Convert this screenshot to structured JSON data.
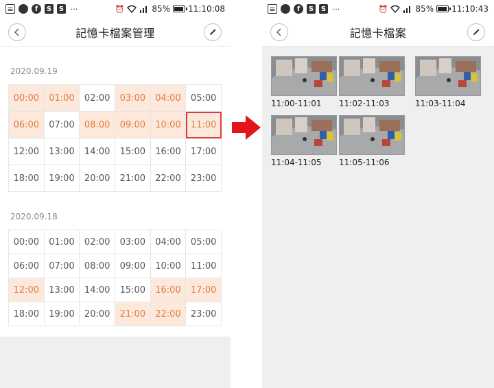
{
  "left": {
    "status": {
      "battery": "85%",
      "time": "11:10:08"
    },
    "title": "記憶卡檔案管理",
    "sections": [
      {
        "date": "2020.09.19",
        "slots": [
          {
            "t": "00:00",
            "has": true
          },
          {
            "t": "01:00",
            "has": true
          },
          {
            "t": "02:00",
            "has": false
          },
          {
            "t": "03:00",
            "has": true
          },
          {
            "t": "04:00",
            "has": true
          },
          {
            "t": "05:00",
            "has": false
          },
          {
            "t": "06:00",
            "has": true
          },
          {
            "t": "07:00",
            "has": false
          },
          {
            "t": "08:00",
            "has": true
          },
          {
            "t": "09:00",
            "has": true
          },
          {
            "t": "10:00",
            "has": true
          },
          {
            "t": "11:00",
            "has": true,
            "selected": true
          },
          {
            "t": "12:00",
            "has": false
          },
          {
            "t": "13:00",
            "has": false
          },
          {
            "t": "14:00",
            "has": false
          },
          {
            "t": "15:00",
            "has": false
          },
          {
            "t": "16:00",
            "has": false
          },
          {
            "t": "17:00",
            "has": false
          },
          {
            "t": "18:00",
            "has": false
          },
          {
            "t": "19:00",
            "has": false
          },
          {
            "t": "20:00",
            "has": false
          },
          {
            "t": "21:00",
            "has": false
          },
          {
            "t": "22:00",
            "has": false
          },
          {
            "t": "23:00",
            "has": false
          }
        ]
      },
      {
        "date": "2020.09.18",
        "slots": [
          {
            "t": "00:00",
            "has": false
          },
          {
            "t": "01:00",
            "has": false
          },
          {
            "t": "02:00",
            "has": false
          },
          {
            "t": "03:00",
            "has": false
          },
          {
            "t": "04:00",
            "has": false
          },
          {
            "t": "05:00",
            "has": false
          },
          {
            "t": "06:00",
            "has": false
          },
          {
            "t": "07:00",
            "has": false
          },
          {
            "t": "08:00",
            "has": false
          },
          {
            "t": "09:00",
            "has": false
          },
          {
            "t": "10:00",
            "has": false
          },
          {
            "t": "11:00",
            "has": false
          },
          {
            "t": "12:00",
            "has": true
          },
          {
            "t": "13:00",
            "has": false
          },
          {
            "t": "14:00",
            "has": false
          },
          {
            "t": "15:00",
            "has": false
          },
          {
            "t": "16:00",
            "has": true
          },
          {
            "t": "17:00",
            "has": true
          },
          {
            "t": "18:00",
            "has": false
          },
          {
            "t": "19:00",
            "has": false
          },
          {
            "t": "20:00",
            "has": false
          },
          {
            "t": "21:00",
            "has": true
          },
          {
            "t": "22:00",
            "has": true
          },
          {
            "t": "23:00",
            "has": false
          }
        ]
      }
    ]
  },
  "right": {
    "status": {
      "battery": "85%",
      "time": "11:10:43"
    },
    "title": "記憶卡檔案",
    "files": [
      {
        "label": "11:00-11:01"
      },
      {
        "label": "11:02-11:03"
      },
      {
        "label": "11:03-11:04"
      },
      {
        "label": "11:04-11:05"
      },
      {
        "label": "11:05-11:06"
      }
    ]
  },
  "colors": {
    "highlight_bg": "#fde8dc",
    "highlight_text": "#e27a3f",
    "selected_border": "#e0393e",
    "arrow": "#e3151b"
  },
  "icons": [
    "notes-icon",
    "dot-icon",
    "facebook-icon",
    "shopee-icon",
    "more-dots-icon",
    "alarm-icon",
    "wifi-icon",
    "signal-icon",
    "battery-icon",
    "back-icon",
    "pencil-icon",
    "arrow-right-icon"
  ]
}
